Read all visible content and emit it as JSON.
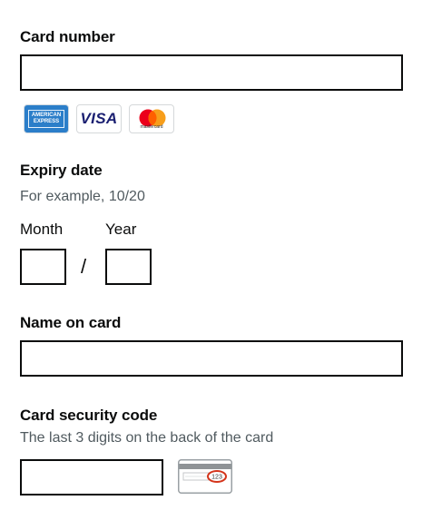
{
  "card_number": {
    "label": "Card number",
    "value": ""
  },
  "card_logos": {
    "amex_line1": "AMERICAN",
    "amex_line2": "EXPRESS",
    "visa": "VISA",
    "mastercard": "mastercard"
  },
  "expiry": {
    "label": "Expiry date",
    "hint": "For example, 10/20",
    "month_label": "Month",
    "year_label": "Year",
    "separator": "/",
    "month_value": "",
    "year_value": ""
  },
  "name_on_card": {
    "label": "Name on card",
    "value": ""
  },
  "security_code": {
    "label": "Card security code",
    "hint": "The last 3 digits on the back of the card",
    "value": "",
    "illustration_digits": "123"
  },
  "colors": {
    "text": "#0b0c0c",
    "hint": "#505a5f",
    "amex_blue": "#2b7ec9",
    "visa_navy": "#1a1f71",
    "mastercard_red": "#eb001b",
    "mastercard_orange": "#f79e1b",
    "cvc_circle": "#d4351c"
  }
}
